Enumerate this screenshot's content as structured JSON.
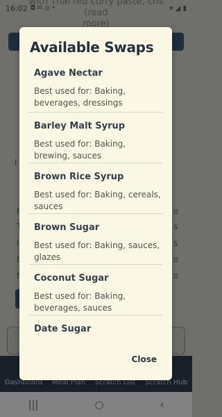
{
  "status_bar": {
    "time": "16:02",
    "icons": "◘ ✉ ◎ •",
    "right_icons": "▾ ◢ ▮"
  },
  "background": {
    "description_line1": "with Thai red curry paste, cris (read",
    "description_line2": "more)",
    "nav": [
      "Dashboard",
      "Meal Plan",
      "Scratch List",
      "Scratch Hub"
    ]
  },
  "modal": {
    "title": "Available Swaps",
    "items": [
      {
        "name": "Agave Nectar",
        "usage": "Best used for: Baking, beverages, dressings"
      },
      {
        "name": "Barley Malt Syrup",
        "usage": "Best used for: Baking, brewing, sauces"
      },
      {
        "name": "Brown Rice Syrup",
        "usage": "Best used for: Baking, cereals, sauces"
      },
      {
        "name": "Brown Sugar",
        "usage": "Best used for: Baking, sauces, glazes"
      },
      {
        "name": "Coconut Sugar",
        "usage": "Best used for: Baking, beverages, sauces"
      },
      {
        "name": "Date Sugar",
        "usage": ""
      }
    ],
    "close_label": "Close"
  },
  "system_nav": {
    "recents": "|||",
    "home": "○",
    "back": "‹"
  }
}
